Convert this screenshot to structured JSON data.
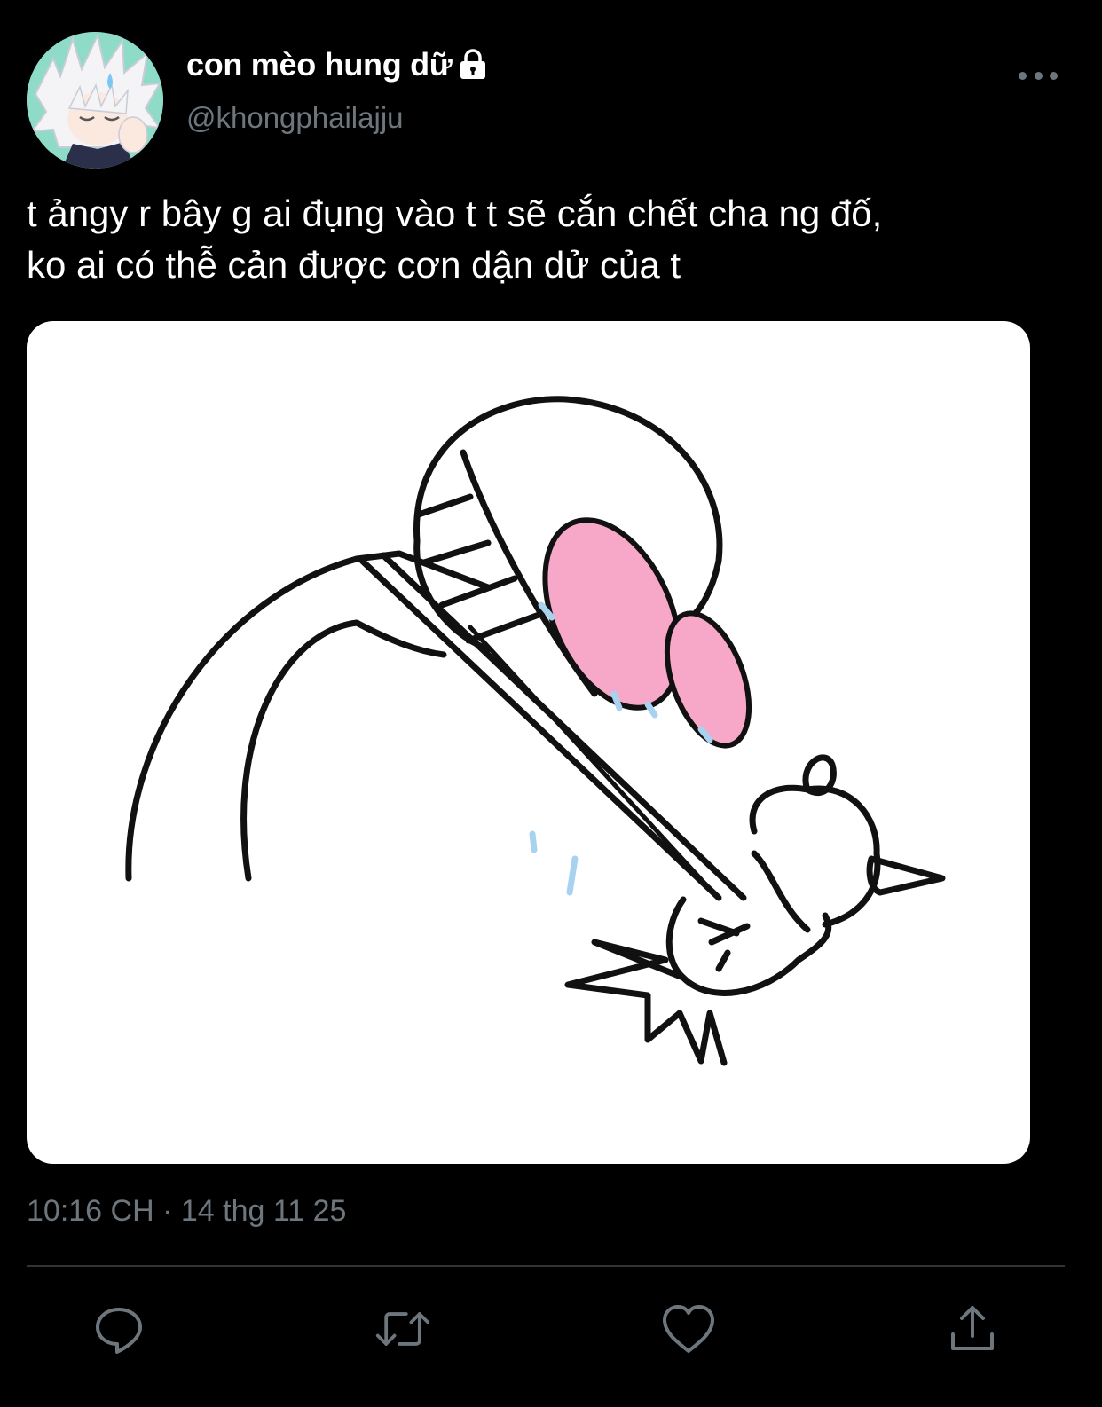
{
  "tweet": {
    "display_name": "con mèo hung dữ",
    "handle": "@khongphailajju",
    "text": "t ảngy r bây g ai đụng vào t t sẽ cắn chết cha ng đố,\nko ai có thễ cản được cơn dận dử của t",
    "timestamp": "10:16 CH · 14 thg 11 25",
    "protected_icon": "lock-icon",
    "more_icon": "more-horizontal-icon"
  },
  "actions": [
    {
      "icon": "reply-icon"
    },
    {
      "icon": "retweet-icon"
    },
    {
      "icon": "like-icon"
    },
    {
      "icon": "share-icon"
    }
  ],
  "colors": {
    "background": "#000000",
    "text_primary": "#ffffff",
    "text_secondary": "#6e767d",
    "divider": "#2f3336",
    "drawing_pink": "#f7a8c8",
    "drawing_tears": "#a8d3f0"
  }
}
